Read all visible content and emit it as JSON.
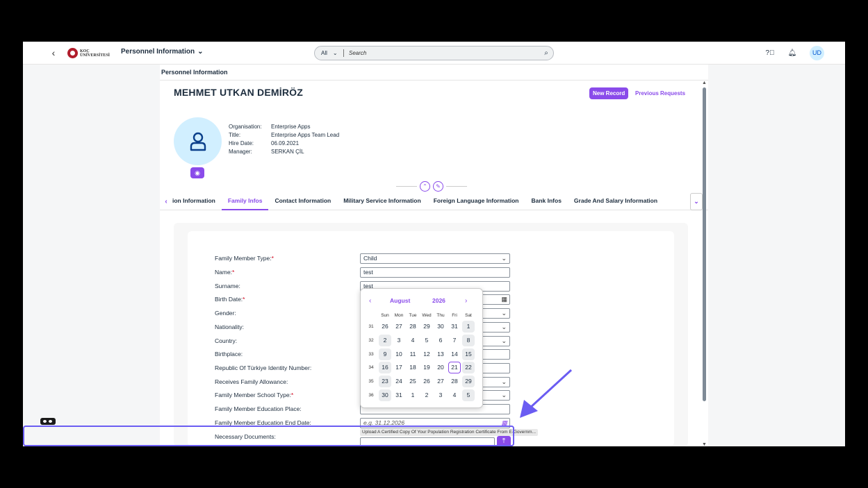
{
  "shell": {
    "logo_text": "KOÇ ÜNİVERSİTESİ",
    "app_title": "Personnel Information",
    "search_scope": "All",
    "search_placeholder": "Search",
    "avatar_initials": "UD"
  },
  "header": {
    "breadcrumb": "Personnel Information",
    "employee_name": "MEHMET UTKAN DEMİRÖZ",
    "new_record_label": "New Record",
    "previous_requests_label": "Previous Requests",
    "info": [
      {
        "label": "Organisation:",
        "value": "Enterprise Apps"
      },
      {
        "label": "Title:",
        "value": "Enterprise Apps Team Lead"
      },
      {
        "label": "Hire Date:",
        "value": "06.09.2021"
      },
      {
        "label": "Manager:",
        "value": "SERKAN ÇİL"
      }
    ]
  },
  "tabs": [
    {
      "label": "ion Information",
      "active": false
    },
    {
      "label": "Family Infos",
      "active": true
    },
    {
      "label": "Contact Information",
      "active": false
    },
    {
      "label": "Military Service Information",
      "active": false
    },
    {
      "label": "Foreign Language Information",
      "active": false
    },
    {
      "label": "Bank Infos",
      "active": false
    },
    {
      "label": "Grade And Salary Information",
      "active": false
    }
  ],
  "form": {
    "family_member_type_label": "Family Member Type:",
    "family_member_type_value": "Child",
    "name_label": "Name:",
    "name_value": "test",
    "surname_label": "Surname:",
    "surname_value": "test",
    "birth_date_label": "Birth Date:",
    "gender_label": "Gender:",
    "nationality_label": "Nationality:",
    "country_label": "Country:",
    "birthplace_label": "Birthplace:",
    "identity_number_label": "Republic Of Türkiye Identity Number:",
    "family_allowance_label": "Receives Family Allowance:",
    "school_type_label": "Family Member School Type:",
    "education_place_label": "Family Member Education Place:",
    "education_end_date_label": "Family Member Education End Date:",
    "education_end_date_placeholder": "e.g. 31.12.2026",
    "necessary_documents_label": "Necessary Documents:",
    "upload_hint": "Upload A Certified Copy Of Your Population Registration Certificate From E-Governm..."
  },
  "calendar": {
    "month": "August",
    "year": "2026",
    "weekdays": [
      "Sun",
      "Mon",
      "Tue",
      "Wed",
      "Thu",
      "Fri",
      "Sat"
    ],
    "weeks": [
      {
        "wk": "31",
        "days": [
          "26",
          "27",
          "28",
          "29",
          "30",
          "31",
          "1"
        ]
      },
      {
        "wk": "32",
        "days": [
          "2",
          "3",
          "4",
          "5",
          "6",
          "7",
          "8"
        ]
      },
      {
        "wk": "33",
        "days": [
          "9",
          "10",
          "11",
          "12",
          "13",
          "14",
          "15"
        ]
      },
      {
        "wk": "34",
        "days": [
          "16",
          "17",
          "18",
          "19",
          "20",
          "21",
          "22"
        ]
      },
      {
        "wk": "35",
        "days": [
          "23",
          "24",
          "25",
          "26",
          "27",
          "28",
          "29"
        ]
      },
      {
        "wk": "36",
        "days": [
          "30",
          "31",
          "1",
          "2",
          "3",
          "4",
          "5"
        ]
      }
    ],
    "today": "21"
  },
  "colors": {
    "accent": "#8a4bea",
    "annotation": "#6a5cf2"
  }
}
